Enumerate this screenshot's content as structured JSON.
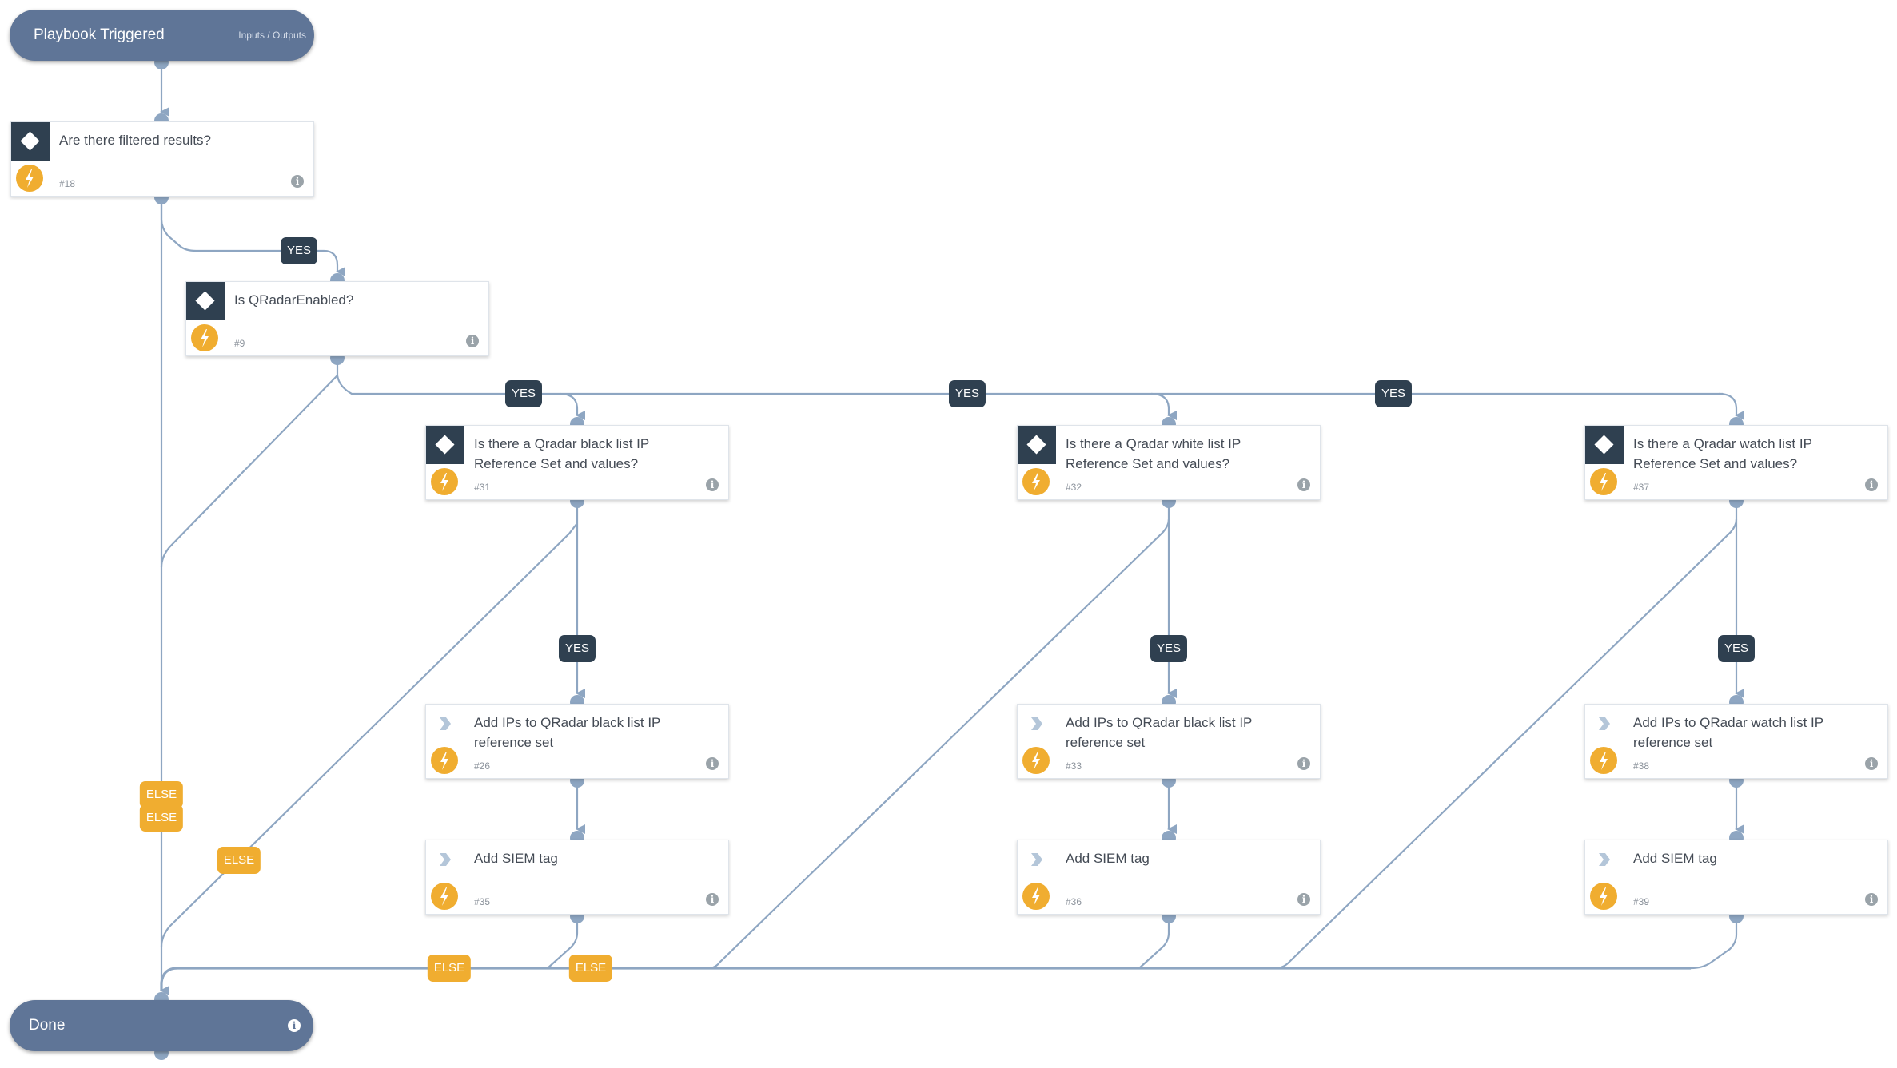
{
  "start": {
    "title": "Playbook Triggered",
    "io_label": "Inputs / Outputs"
  },
  "end": {
    "title": "Done"
  },
  "colors": {
    "terminal": "#5f7597",
    "condition_icon_bg": "#2f4050",
    "automation_icon": "#f0ad30",
    "edge": "#8ea6c2",
    "yes_tag": "#2f4050",
    "else_tag": "#f0ad30"
  },
  "nodes": [
    {
      "id": "18",
      "type": "condition",
      "label": "Are there filtered results?",
      "number": "#18"
    },
    {
      "id": "9",
      "type": "condition",
      "label": "Is QRadarEnabled?",
      "number": "#9"
    },
    {
      "id": "31",
      "type": "condition",
      "label": "Is there a Qradar black list IP Reference Set and values?",
      "number": "#31"
    },
    {
      "id": "32",
      "type": "condition",
      "label": "Is there a Qradar white list IP Reference Set and values?",
      "number": "#32"
    },
    {
      "id": "37",
      "type": "condition",
      "label": "Is there a Qradar watch list IP Reference Set and values?",
      "number": "#37"
    },
    {
      "id": "26",
      "type": "action",
      "label": "Add IPs to QRadar black list IP reference set",
      "number": "#26"
    },
    {
      "id": "33",
      "type": "action",
      "label": "Add IPs to QRadar black list IP reference set",
      "number": "#33"
    },
    {
      "id": "38",
      "type": "action",
      "label": "Add IPs to QRadar watch list IP reference set",
      "number": "#38"
    },
    {
      "id": "35",
      "type": "action",
      "label": "Add SIEM tag",
      "number": "#35"
    },
    {
      "id": "36",
      "type": "action",
      "label": "Add SIEM tag",
      "number": "#36"
    },
    {
      "id": "39",
      "type": "action",
      "label": "Add SIEM tag",
      "number": "#39"
    }
  ],
  "edge_labels": {
    "yes": "YES",
    "else": "ELSE"
  },
  "edges": [
    {
      "from": "start",
      "to": "18",
      "label": ""
    },
    {
      "from": "18",
      "to": "9",
      "label": "YES"
    },
    {
      "from": "18",
      "to": "end",
      "label": "ELSE"
    },
    {
      "from": "9",
      "to": "31",
      "label": "YES"
    },
    {
      "from": "9",
      "to": "32",
      "label": "YES"
    },
    {
      "from": "9",
      "to": "37",
      "label": "YES"
    },
    {
      "from": "9",
      "to": "end",
      "label": "ELSE"
    },
    {
      "from": "31",
      "to": "26",
      "label": "YES"
    },
    {
      "from": "31",
      "to": "end",
      "label": "ELSE"
    },
    {
      "from": "32",
      "to": "33",
      "label": "YES"
    },
    {
      "from": "32",
      "to": "end",
      "label": "ELSE"
    },
    {
      "from": "37",
      "to": "38",
      "label": "YES"
    },
    {
      "from": "37",
      "to": "end",
      "label": "ELSE"
    },
    {
      "from": "26",
      "to": "35",
      "label": ""
    },
    {
      "from": "33",
      "to": "36",
      "label": ""
    },
    {
      "from": "38",
      "to": "39",
      "label": ""
    },
    {
      "from": "35",
      "to": "end",
      "label": ""
    },
    {
      "from": "36",
      "to": "end",
      "label": ""
    },
    {
      "from": "39",
      "to": "end",
      "label": ""
    }
  ]
}
